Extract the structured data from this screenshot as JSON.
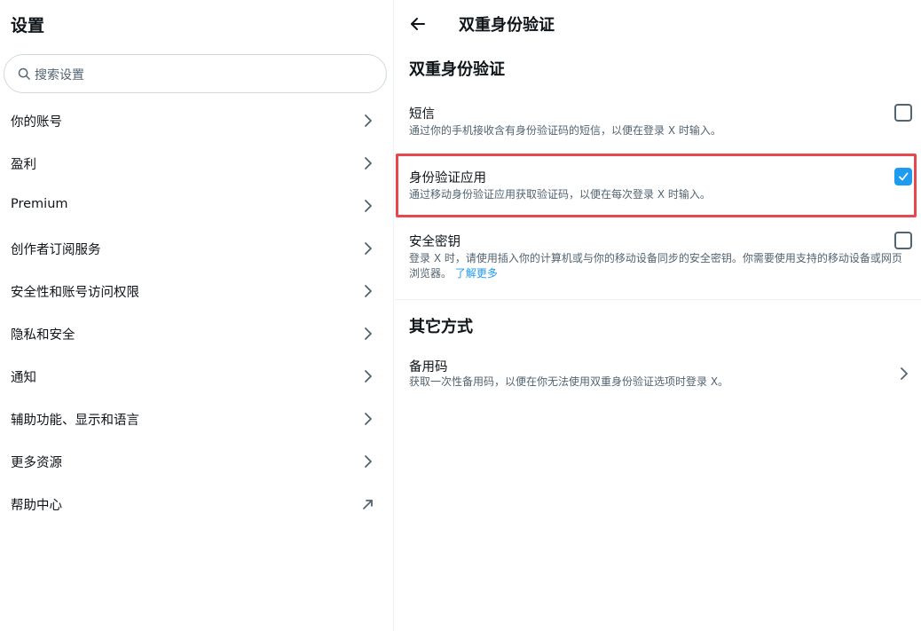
{
  "left": {
    "title": "设置",
    "search_placeholder": "搜索设置",
    "items": [
      {
        "label": "你的账号",
        "icon": "chevron-right-icon"
      },
      {
        "label": "盈利",
        "icon": "chevron-right-icon"
      },
      {
        "label": "Premium",
        "icon": "chevron-right-icon"
      },
      {
        "label": "创作者订阅服务",
        "icon": "chevron-right-icon"
      },
      {
        "label": "安全性和账号访问权限",
        "icon": "chevron-right-icon"
      },
      {
        "label": "隐私和安全",
        "icon": "chevron-right-icon"
      },
      {
        "label": "通知",
        "icon": "chevron-right-icon"
      },
      {
        "label": "辅助功能、显示和语言",
        "icon": "chevron-right-icon"
      },
      {
        "label": "更多资源",
        "icon": "chevron-right-icon"
      },
      {
        "label": "帮助中心",
        "icon": "external-link-icon"
      }
    ]
  },
  "right": {
    "header_title": "双重身份验证",
    "section_title": "双重身份验证",
    "options": [
      {
        "title": "短信",
        "desc": "通过你的手机接收含有身份验证码的短信，以便在登录 X 时输入。",
        "checked": false
      },
      {
        "title": "身份验证应用",
        "desc": "通过移动身份验证应用获取验证码，以便在每次登录 X 时输入。",
        "checked": true
      },
      {
        "title": "安全密钥",
        "desc": "登录 X 时，请使用插入你的计算机或与你的移动设备同步的安全密钥。你需要使用支持的移动设备或网页浏览器。",
        "link": "了解更多",
        "checked": false
      }
    ],
    "other_title": "其它方式",
    "backup": {
      "title": "备用码",
      "desc": "获取一次性备用码，以便在你无法使用双重身份验证选项时登录 X。"
    }
  },
  "colors": {
    "accent": "#1d9bf0",
    "highlight": "#e8474d",
    "muted": "#536471"
  }
}
